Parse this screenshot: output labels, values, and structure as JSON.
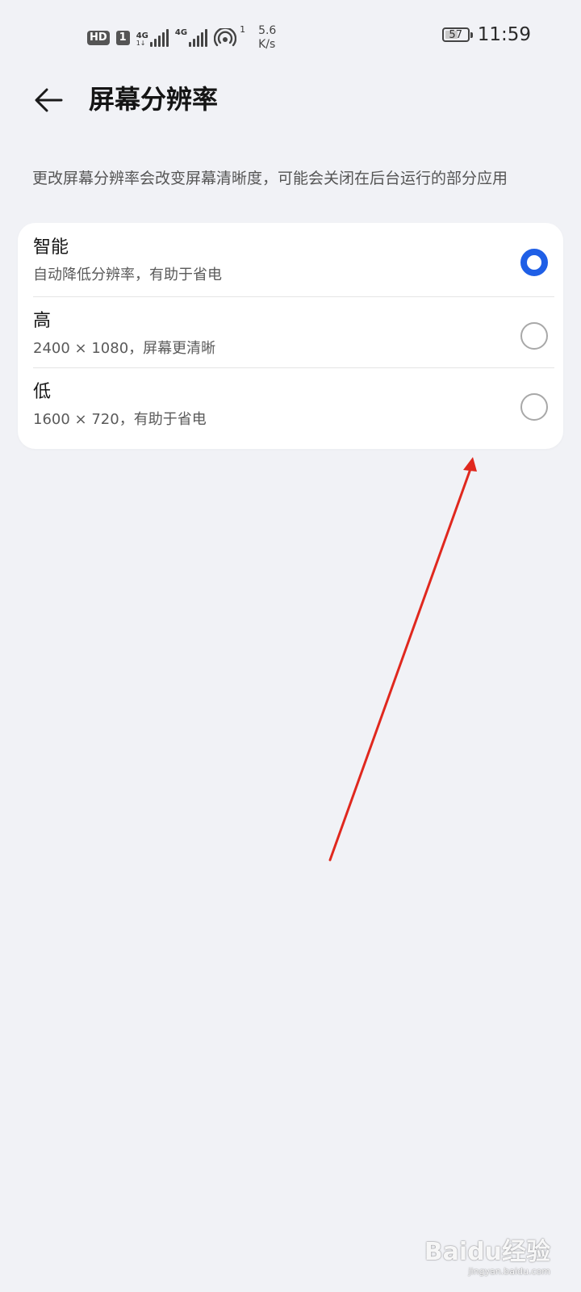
{
  "status_bar": {
    "hd_label": "HD",
    "sim_label": "1",
    "network1_label": "4G",
    "network1_sub": "1↓",
    "network2_label": "4G",
    "hotspot_count": "1",
    "speed_value": "5.6",
    "speed_unit": "K/s",
    "battery_level": "57",
    "battery_fraction": 0.57,
    "time": "11:59"
  },
  "header": {
    "back_icon": "arrow-left-icon",
    "title": "屏幕分辨率"
  },
  "description": "更改屏幕分辨率会改变屏幕清晰度，可能会关闭在后台运行的部分应用",
  "options": [
    {
      "title": "智能",
      "subtitle": "自动降低分辨率，有助于省电",
      "selected": true
    },
    {
      "title": "高",
      "subtitle": "2400 × 1080，屏幕更清晰",
      "selected": false
    },
    {
      "title": "低",
      "subtitle": "1600 × 720，有助于省电",
      "selected": false
    }
  ],
  "colors": {
    "background": "#f1f2f6",
    "card": "#ffffff",
    "accent": "#1f5fe6",
    "annotation": "#e0281e"
  },
  "watermark": {
    "logo": "Baidu经验",
    "url": "jingyan.baidu.com"
  }
}
